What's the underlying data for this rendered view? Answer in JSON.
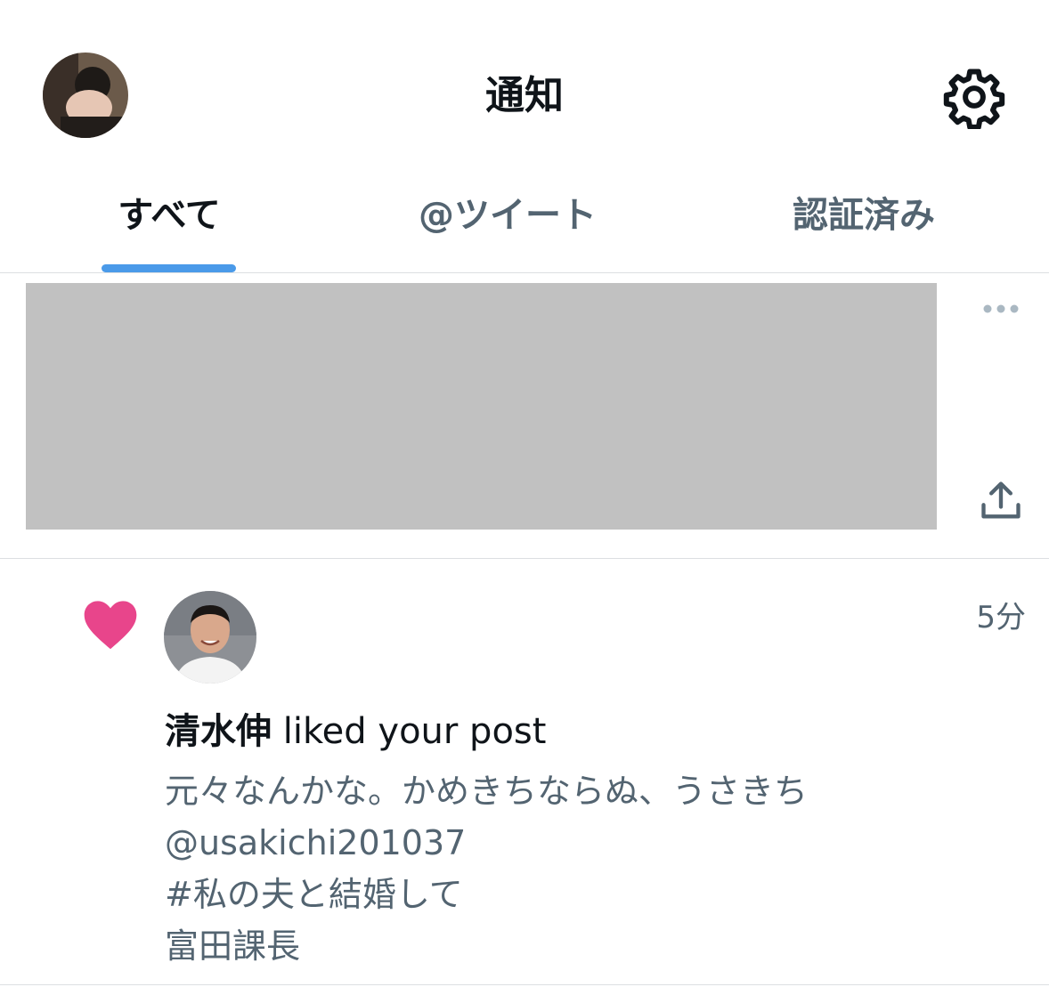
{
  "header": {
    "title": "通知",
    "avatar_icon": "profile-avatar-icon",
    "settings_icon": "gear-icon"
  },
  "tabs": [
    {
      "label": "すべて",
      "active": true
    },
    {
      "label": "@ツイート",
      "active": false
    },
    {
      "label": "認証済み",
      "active": false
    }
  ],
  "colors": {
    "tab_indicator": "#4a9ae9",
    "heart": "#e8458b",
    "secondary_text": "#536471",
    "redacted": "#c1c1c1"
  },
  "notifications": [
    {
      "redacted": true,
      "more_icon": "more-horizontal-icon",
      "share_icon": "share-icon"
    },
    {
      "type_icon": "heart-icon",
      "user_name": "清水伸",
      "action": " liked your post",
      "time": "5分",
      "post_lines": [
        "元々なんかな。かめきちならぬ、うさきち",
        "@usakichi201037",
        "#私の夫と結婚して",
        "富田課長"
      ]
    }
  ]
}
